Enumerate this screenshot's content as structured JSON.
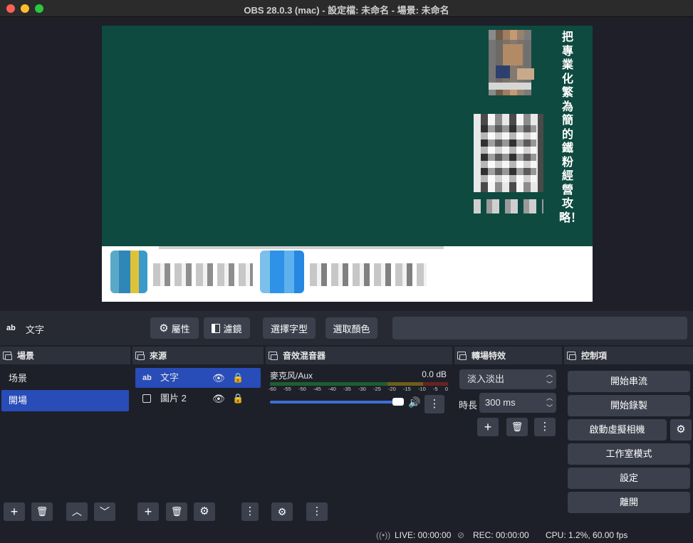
{
  "window": {
    "title": "OBS 28.0.3 (mac) - 設定檔: 未命名 - 場景: 未命名"
  },
  "canvas": {
    "vertical_text": "把專業化繁為簡的鐵粉經營攻略！"
  },
  "context_bar": {
    "source_type_icon": "ab",
    "source_name": "文字",
    "properties_label": "屬性",
    "filters_label": "濾鏡",
    "select_font_label": "選擇字型",
    "select_color_label": "選取顏色"
  },
  "scenes": {
    "title": "場景",
    "items": [
      "场景",
      "開場"
    ],
    "selected_index": 1
  },
  "sources": {
    "title": "來源",
    "items": [
      {
        "type_icon": "ab",
        "name": "文字",
        "visible": true,
        "locked": false
      },
      {
        "type_icon": "image-icon",
        "name": "圖片 2",
        "visible": true,
        "locked": false
      }
    ]
  },
  "mixer": {
    "title": "音效混音器",
    "channel_name": "麥克风/Aux",
    "channel_db": "0.0 dB",
    "ticks": [
      "-60",
      "-55",
      "-50",
      "-45",
      "-40",
      "-35",
      "-30",
      "-25",
      "-20",
      "-15",
      "-10",
      "-5",
      "0"
    ],
    "volume": 1.0
  },
  "transitions": {
    "title": "轉場特效",
    "selected": "淡入淡出",
    "duration_label": "時長",
    "duration_value": "300 ms"
  },
  "controls": {
    "title": "控制項",
    "start_streaming": "開始串流",
    "start_recording": "開始錄製",
    "start_virtual_cam": "啟動虛擬相機",
    "studio_mode": "工作室模式",
    "settings": "設定",
    "exit": "離開"
  },
  "status": {
    "live": "LIVE: 00:00:00",
    "rec": "REC: 00:00:00",
    "cpu": "CPU: 1.2%, 60.00 fps"
  },
  "colors": {
    "accent": "#284cb8",
    "canvas_bg": "#0e4a3f",
    "button_bg": "#3c404d"
  }
}
